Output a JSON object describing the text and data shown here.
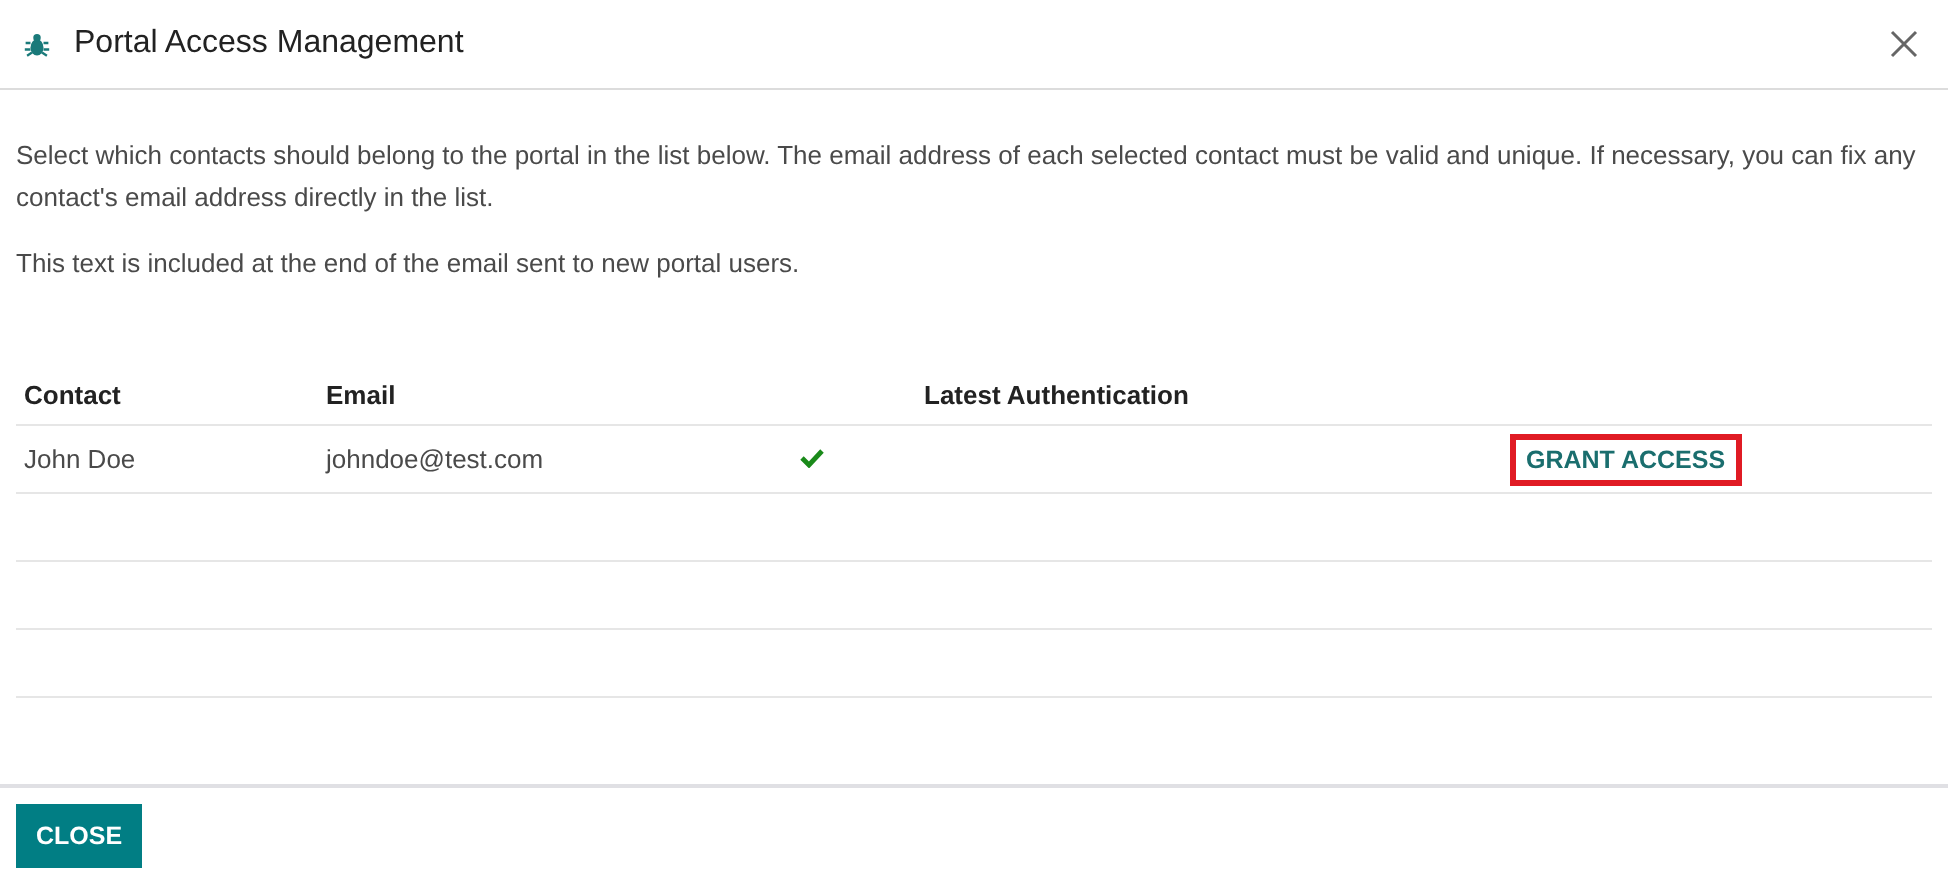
{
  "dialog": {
    "title": "Portal Access Management"
  },
  "intro": "Select which contacts should belong to the portal in the list below. The email address of each selected contact must be valid and unique. If necessary, you can fix any contact's email address directly in the list.",
  "note": "This text is included at the end of the email sent to new portal users.",
  "table": {
    "columns": [
      "Contact",
      "Email",
      "",
      "Latest Authentication",
      ""
    ],
    "rows": [
      {
        "contact": "John Doe",
        "email": "johndoe@test.com",
        "email_valid": true,
        "latest_authentication": "",
        "action": {
          "label": "GRANT ACCESS",
          "highlighted": true
        }
      }
    ]
  },
  "footer": {
    "buttons": [
      "CLOSE"
    ]
  }
}
